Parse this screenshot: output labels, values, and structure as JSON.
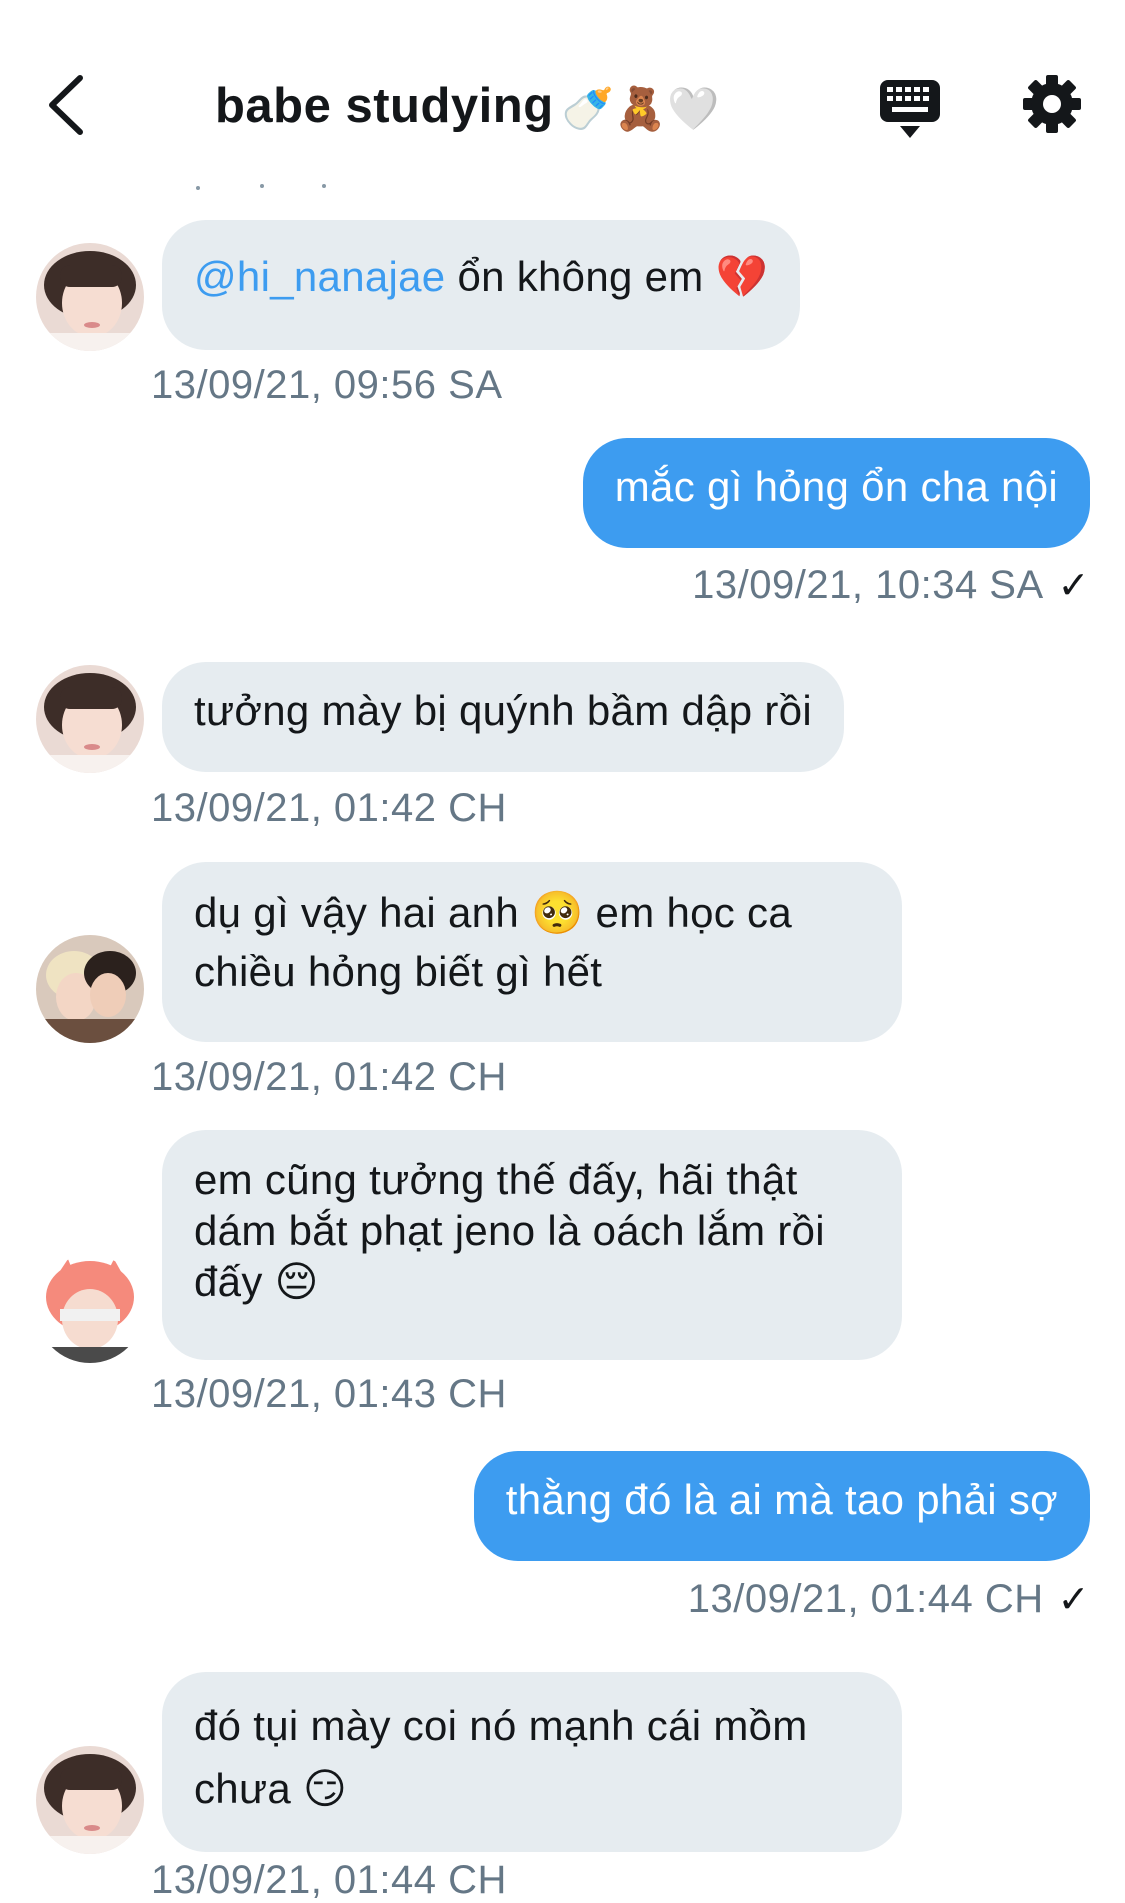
{
  "header": {
    "title": "babe studying",
    "title_emoji": "🍼🧸🤍"
  },
  "icons": {
    "back": "chevron-left-icon",
    "keyboard": "keyboard-icon",
    "settings": "gear-icon"
  },
  "colors": {
    "outgoing_bubble": "#3d9cf0",
    "incoming_bubble": "#e6ecf0",
    "mention": "#3d9cf0",
    "timestamp": "#657786"
  },
  "messages": [
    {
      "direction": "in",
      "mention": "@hi_nanajae",
      "text": " ổn không em 💔",
      "timestamp": "13/09/21, 09:56 SA"
    },
    {
      "direction": "out",
      "text": "mắc gì hỏng ổn cha nội",
      "timestamp": "13/09/21, 10:34 SA",
      "receipt": "✓"
    },
    {
      "direction": "in",
      "text": "tưởng mày bị quýnh bầm dập rồi",
      "timestamp": "13/09/21, 01:42 CH"
    },
    {
      "direction": "in",
      "text": "dụ gì vậy hai anh 🥺 em học ca chiều hỏng biết gì hết",
      "timestamp": "13/09/21, 01:42 CH"
    },
    {
      "direction": "in",
      "text": "em cũng tưởng thế đấy, hãi thật dám bắt phạt jeno là oách lắm rồi đấy 😔",
      "timestamp": "13/09/21, 01:43 CH"
    },
    {
      "direction": "out",
      "text": "thằng đó là ai mà tao phải sợ",
      "timestamp": "13/09/21, 01:44 CH",
      "receipt": "✓"
    },
    {
      "direction": "in",
      "text": "đó tụi mày coi nó mạnh cái mồm chưa 😏",
      "timestamp": "13/09/21, 01:44 CH"
    }
  ]
}
